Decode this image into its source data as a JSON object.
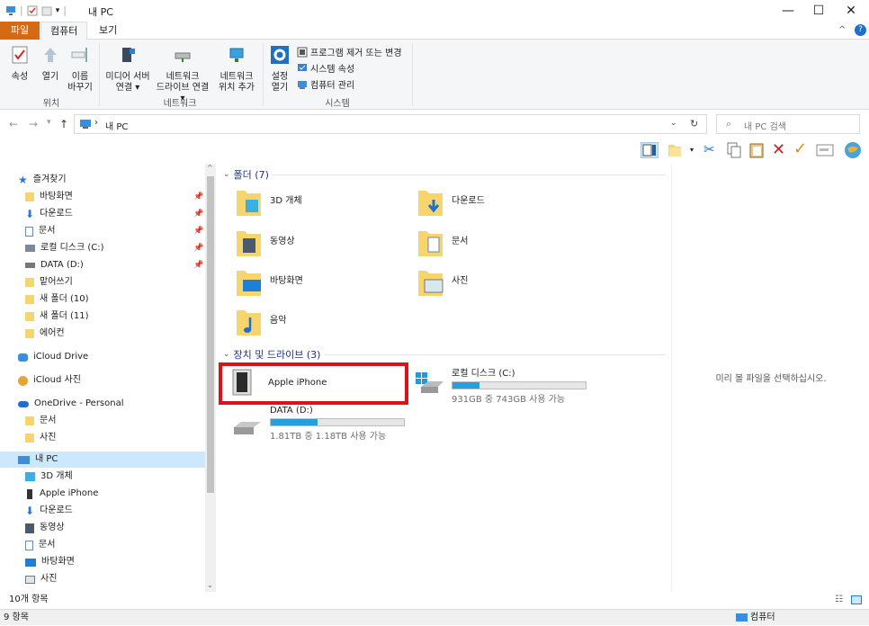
{
  "window": {
    "title": "내 PC",
    "minimize": "—",
    "maximize": "☐",
    "close": "✕"
  },
  "tabs": {
    "file": "파일",
    "computer": "컴퓨터",
    "view": "보기"
  },
  "ribbon": {
    "location": {
      "props": "속성",
      "open": "열기",
      "rename1": "이름",
      "rename2": "바꾸기",
      "group": "위치"
    },
    "network": {
      "media1": "미디어 서버",
      "media2": "연결 ▾",
      "drive1": "네트워크",
      "drive2": "드라이브 연결 ▾",
      "loc1": "네트워크",
      "loc2": "위치 추가",
      "group": "네트워크"
    },
    "system": {
      "settings1": "설정",
      "settings2": "열기",
      "uninstall": "프로그램 제거 또는 변경",
      "sysprops": "시스템 속성",
      "manage": "컴퓨터 관리",
      "group": "시스템"
    }
  },
  "address": {
    "path": "내 PC",
    "separator": "›",
    "search_placeholder": "내 PC 검색"
  },
  "nav": {
    "quick": "즐겨찾기",
    "items": [
      "바탕화면",
      "다운로드",
      "문서",
      "로컬 디스크 (C:)",
      "DATA (D:)",
      "맡어쓰기",
      "새 폴더 (10)",
      "새 폴더 (11)",
      "에어컨"
    ],
    "icloud_drive": "iCloud Drive",
    "icloud_photos": "iCloud 사진",
    "onedrive": "OneDrive - Personal",
    "onedrive_items": [
      "문서",
      "사진"
    ],
    "thispc": "내 PC",
    "pc_items": [
      "3D 개체",
      "Apple iPhone",
      "다운로드",
      "동영상",
      "문서",
      "바탕화면",
      "사진"
    ]
  },
  "content": {
    "folders_header": "폴더 (7)",
    "folders": [
      "3D 개체",
      "다운로드",
      "동영상",
      "문서",
      "바탕화면",
      "사진",
      "음악"
    ],
    "devices_header": "장치 및 드라이브 (3)",
    "iphone": "Apple iPhone",
    "c_drive": {
      "name": "로컬 디스크 (C:)",
      "info": "931GB 중 743GB 사용 가능",
      "used_fraction": 0.2
    },
    "d_drive": {
      "name": "DATA (D:)",
      "info": "1.81TB 중 1.18TB 사용 가능",
      "used_fraction": 0.35
    }
  },
  "preview": {
    "text": "미리 볼 파일을 선택하십시오."
  },
  "status": {
    "items": "10개 항목",
    "bottom": "9 항목",
    "computer": "컴퓨터"
  },
  "colors": {
    "highlight": "#e0101b",
    "accent": "#26a0da",
    "file_tab": "#d46a14"
  }
}
